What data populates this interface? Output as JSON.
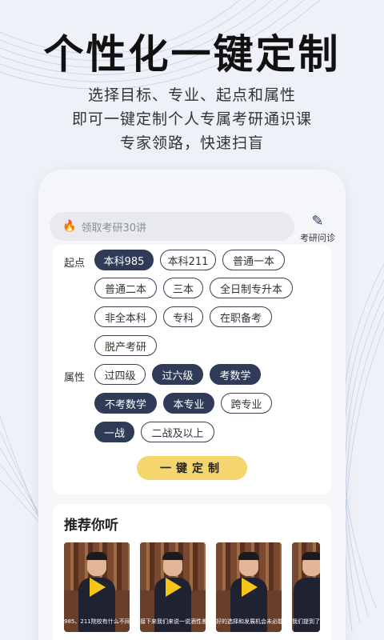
{
  "headline": "个性化一键定制",
  "sub_lines": [
    "选择目标、专业、起点和属性",
    "即可一键定制个人专属考研通识课",
    "专家领路，快速扫盲"
  ],
  "search": {
    "icon": "flame-icon",
    "placeholder": "领取考研30讲"
  },
  "diagnosis": {
    "icon": "pen-icon",
    "label": "考研问诊"
  },
  "start_label": "起点",
  "start_options": [
    {
      "label": "本科985",
      "selected": true
    },
    {
      "label": "本科211",
      "selected": false
    },
    {
      "label": "普通一本",
      "selected": false
    },
    {
      "label": "普通二本",
      "selected": false
    },
    {
      "label": "三本",
      "selected": false
    },
    {
      "label": "全日制专升本",
      "selected": false
    },
    {
      "label": "非全本科",
      "selected": false
    },
    {
      "label": "专科",
      "selected": false
    },
    {
      "label": "在职备考",
      "selected": false
    },
    {
      "label": "脱产考研",
      "selected": false
    }
  ],
  "attr_label": "属性",
  "attr_options": [
    {
      "label": "过四级",
      "selected": false
    },
    {
      "label": "过六级",
      "selected": true
    },
    {
      "label": "考数学",
      "selected": true
    },
    {
      "label": "不考数学",
      "selected": true
    },
    {
      "label": "本专业",
      "selected": true
    },
    {
      "label": "跨专业",
      "selected": false
    },
    {
      "label": "一战",
      "selected": true
    },
    {
      "label": "二战及以上",
      "selected": false
    }
  ],
  "cta_label": "一键定制",
  "recommend_title": "推荐你听",
  "videos": [
    {
      "caption": "985、211院校有什么不同"
    },
    {
      "caption": "接下来我们来说一说酒性差异"
    },
    {
      "caption": "好的选择和发展机会未必能带"
    },
    {
      "caption": "我们提到了34"
    }
  ],
  "colors": {
    "accent_dark": "#2f3b57",
    "cta_yellow": "#f5d66e",
    "flame": "#e8553b"
  }
}
